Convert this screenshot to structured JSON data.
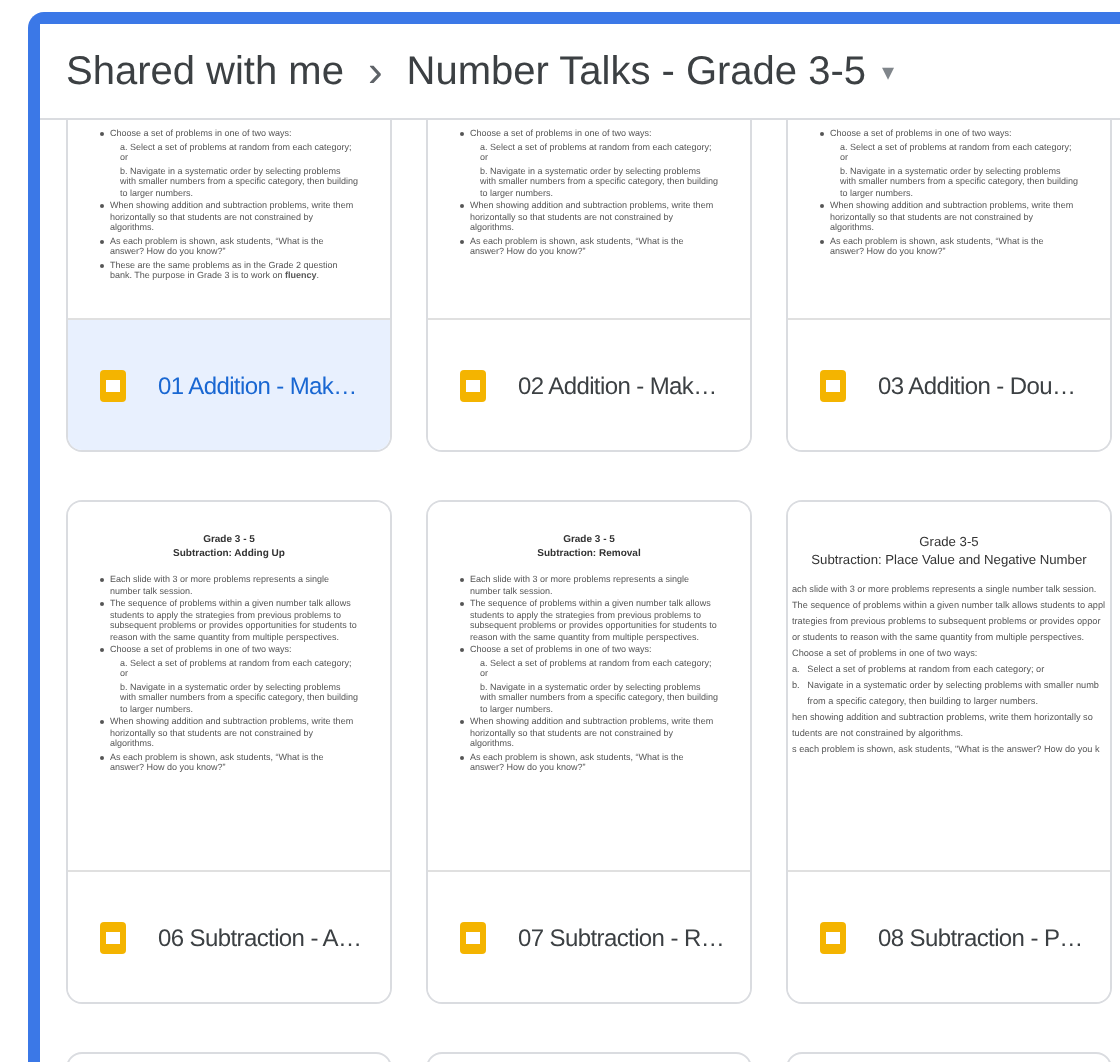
{
  "breadcrumb": {
    "root": "Shared with me",
    "separator": "›",
    "folder": "Number Talks - Grade 3-5",
    "menu": "▾"
  },
  "rows": [
    {
      "cut_top": true,
      "files": [
        {
          "name": "01 Addition - Mak…",
          "selected": true,
          "thumbnail": {
            "items": [
              {
                "kind": "bullet",
                "text": "Choose a set of problems in one of two ways:"
              },
              {
                "kind": "sub",
                "text": "a. Select a set of problems at random from each category; or"
              },
              {
                "kind": "sub",
                "text": "b. Navigate in a systematic order by selecting problems with smaller numbers from a specific category, then building to larger numbers."
              },
              {
                "kind": "bullet",
                "text": "When showing addition and subtraction problems, write them horizontally so that students are not constrained by algorithms."
              },
              {
                "kind": "bullet",
                "text": "As each problem is shown, ask students, “What is the answer? How do you know?”"
              },
              {
                "kind": "bullet",
                "text": "These are the same problems as in the Grade 2 question bank. The purpose in Grade 3 is to work on **fluency**."
              }
            ]
          }
        },
        {
          "name": "02 Addition - Mak…",
          "selected": false,
          "thumbnail": {
            "items": [
              {
                "kind": "bullet",
                "text": "Choose a set of problems in one of two ways:"
              },
              {
                "kind": "sub",
                "text": "a. Select a set of problems at random from each category; or"
              },
              {
                "kind": "sub",
                "text": "b. Navigate in a systematic order by selecting problems with smaller numbers from a specific category, then building to larger numbers."
              },
              {
                "kind": "bullet",
                "text": "When showing addition and subtraction problems, write them horizontally so that students are not constrained by algorithms."
              },
              {
                "kind": "bullet",
                "text": "As each problem is shown, ask students, “What is the answer? How do you know?”"
              }
            ]
          }
        },
        {
          "name": "03 Addition - Dou…",
          "selected": false,
          "thumbnail": {
            "items": [
              {
                "kind": "bullet",
                "text": "Choose a set of problems in one of two ways:"
              },
              {
                "kind": "sub",
                "text": "a. Select a set of problems at random from each category; or"
              },
              {
                "kind": "sub",
                "text": "b. Navigate in a systematic order by selecting problems with smaller numbers from a specific category, then building to larger numbers."
              },
              {
                "kind": "bullet",
                "text": "When showing addition and subtraction problems, write them horizontally so that students are not constrained by algorithms."
              },
              {
                "kind": "bullet",
                "text": "As each problem is shown, ask students, “What is the answer? How do you know?”"
              }
            ]
          }
        }
      ]
    },
    {
      "cut_top": false,
      "files": [
        {
          "name": "06 Subtraction - A…",
          "selected": false,
          "thumbnail": {
            "heading": [
              "Grade 3 - 5",
              "Subtraction: Adding Up"
            ],
            "items": [
              {
                "kind": "bullet",
                "text": "Each slide with 3 or more problems represents a single number talk session."
              },
              {
                "kind": "bullet",
                "text": "The sequence of problems within a given number talk allows students to apply the strategies from previous problems to subsequent problems or provides opportunities for students to reason with the same quantity from multiple perspectives."
              },
              {
                "kind": "bullet",
                "text": "Choose a set of problems in one of two ways:"
              },
              {
                "kind": "sub",
                "text": "a. Select a set of problems at random from each category; or"
              },
              {
                "kind": "sub",
                "text": "b. Navigate in a systematic order by selecting problems with smaller numbers from a specific category, then building to larger numbers."
              },
              {
                "kind": "bullet",
                "text": "When showing addition and subtraction problems, write them horizontally so that students are not constrained by algorithms."
              },
              {
                "kind": "bullet",
                "text": "As each problem is shown, ask students, “What is the answer? How do you know?”"
              }
            ]
          }
        },
        {
          "name": "07 Subtraction - R…",
          "selected": false,
          "thumbnail": {
            "heading": [
              "Grade 3 - 5",
              "Subtraction: Removal"
            ],
            "items": [
              {
                "kind": "bullet",
                "text": "Each slide with 3 or more problems represents a single number talk session."
              },
              {
                "kind": "bullet",
                "text": "The sequence of problems within a given number talk allows students to apply the strategies from previous problems to subsequent problems or provides opportunities for students to reason with the same quantity from multiple perspectives."
              },
              {
                "kind": "bullet",
                "text": "Choose a set of problems in one of two ways:"
              },
              {
                "kind": "sub",
                "text": "a. Select a set of problems at random from each category; or"
              },
              {
                "kind": "sub",
                "text": "b. Navigate in a systematic order by selecting problems with smaller numbers from a specific category, then building to larger numbers."
              },
              {
                "kind": "bullet",
                "text": "When showing addition and subtraction problems, write them horizontally so that students are not constrained by algorithms."
              },
              {
                "kind": "bullet",
                "text": "As each problem is shown, ask students, “What is the answer? How do you know?”"
              }
            ]
          }
        },
        {
          "name": "08 Subtraction - P…",
          "selected": false,
          "thumbnail": {
            "heading": [
              "Grade 3-5",
              "Subtraction: Place Value and Negative Number"
            ],
            "items": [
              {
                "kind": "line",
                "text": "ach slide with 3 or more problems represents a single number talk session."
              },
              {
                "kind": "line",
                "text": "The sequence of problems within a given number talk allows students to appl"
              },
              {
                "kind": "line",
                "text": "trategies from previous problems to subsequent problems or provides oppor"
              },
              {
                "kind": "line",
                "text": "or students to reason with the same quantity from multiple perspectives."
              },
              {
                "kind": "line",
                "text": "Choose a set of problems in one of two ways:"
              },
              {
                "kind": "line",
                "text": "a.   Select a set of problems at random from each category; or"
              },
              {
                "kind": "line",
                "text": "b.   Navigate in a systematic order by selecting problems with smaller numb"
              },
              {
                "kind": "line",
                "text": "      from a specific category, then building to larger numbers."
              },
              {
                "kind": "line",
                "text": "hen showing addition and subtraction problems, write them horizontally so"
              },
              {
                "kind": "line",
                "text": "tudents are not constrained by algorithms."
              },
              {
                "kind": "line",
                "text": "s each problem is shown, ask students, \"What is the answer? How do you k"
              }
            ]
          }
        }
      ]
    }
  ]
}
